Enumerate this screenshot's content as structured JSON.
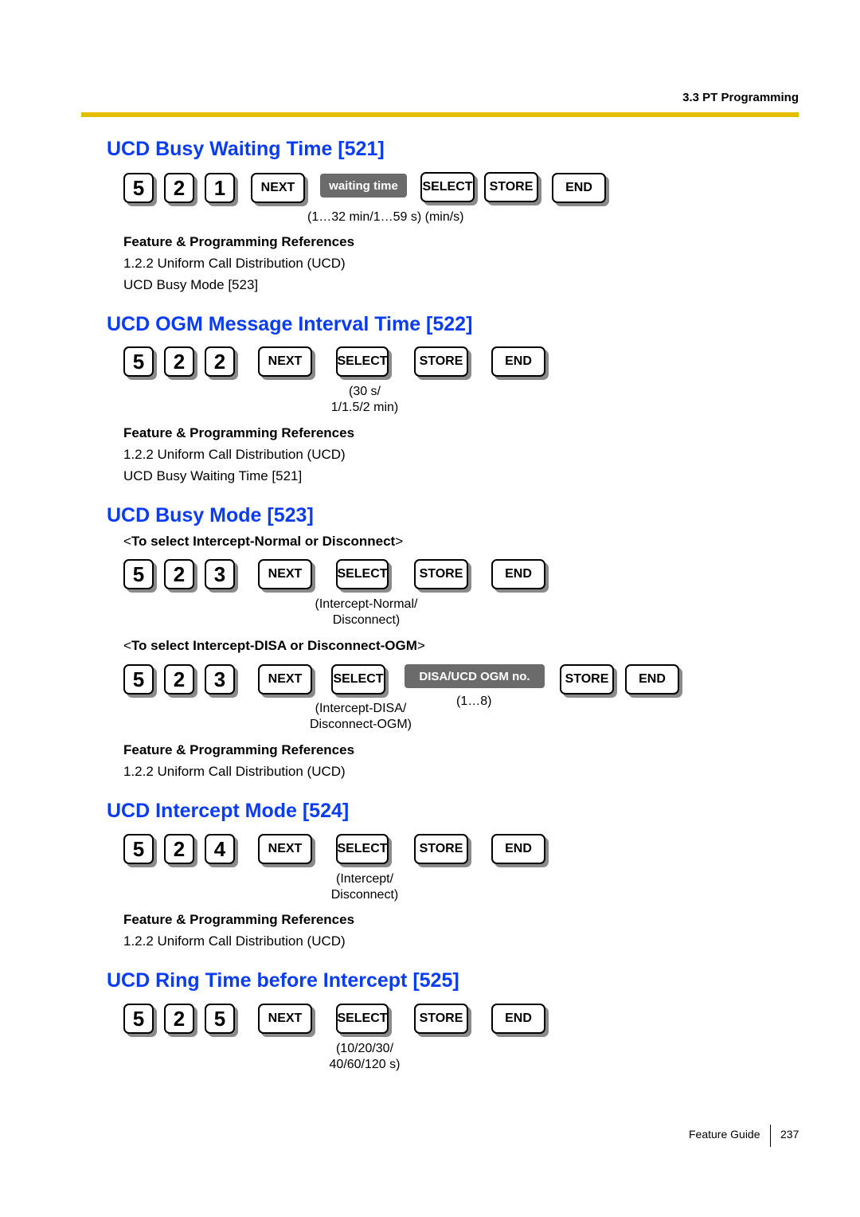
{
  "header": {
    "section": "3.3 PT Programming",
    "rule_color": "#e3bd00"
  },
  "heading_color": "#0a3cf5",
  "sections": [
    {
      "title": "UCD Busy Waiting Time [521]",
      "keys": [
        "5",
        "2",
        "1",
        "NEXT",
        "waiting time",
        "SELECT",
        "STORE",
        "END"
      ],
      "notes": [
        "(1…32 min/1…59 s)  (min/s)"
      ],
      "refs_heading": "Feature & Programming References",
      "refs": [
        "1.2.2 Uniform Call Distribution (UCD)",
        "UCD Busy Mode [523]"
      ]
    },
    {
      "title": "UCD OGM Message Interval Time [522]",
      "keys": [
        "5",
        "2",
        "2",
        "NEXT",
        "SELECT",
        "STORE",
        "END"
      ],
      "notes": [
        "(30 s/",
        "1/1.5/2 min)"
      ],
      "refs_heading": "Feature & Programming References",
      "refs": [
        "1.2.2 Uniform Call Distribution (UCD)",
        "UCD Busy Waiting Time [521]"
      ]
    },
    {
      "title": "UCD Busy Mode [523]",
      "sub1": "To select Intercept-Normal or Disconnect",
      "keys1": [
        "5",
        "2",
        "3",
        "NEXT",
        "SELECT",
        "STORE",
        "END"
      ],
      "notes1": [
        "(Intercept-Normal/",
        "Disconnect)"
      ],
      "sub2": "To select Intercept-DISA or Disconnect-OGM",
      "keys2": [
        "5",
        "2",
        "3",
        "NEXT",
        "SELECT",
        "DISA/UCD OGM no.",
        "STORE",
        "END"
      ],
      "notes2": [
        "(Intercept-DISA/",
        "Disconnect-OGM)",
        "(1…8)"
      ],
      "refs_heading": "Feature & Programming References",
      "refs": [
        "1.2.2 Uniform Call Distribution (UCD)"
      ]
    },
    {
      "title": "UCD Intercept Mode [524]",
      "keys": [
        "5",
        "2",
        "4",
        "NEXT",
        "SELECT",
        "STORE",
        "END"
      ],
      "notes": [
        "(Intercept/",
        "Disconnect)"
      ],
      "refs_heading": "Feature & Programming References",
      "refs": [
        "1.2.2 Uniform Call Distribution (UCD)"
      ]
    },
    {
      "title": "UCD Ring Time before Intercept [525]",
      "keys": [
        "5",
        "2",
        "5",
        "NEXT",
        "SELECT",
        "STORE",
        "END"
      ],
      "notes": [
        "(10/20/30/",
        "40/60/120 s)"
      ]
    }
  ],
  "brackets": {
    "open": "<",
    "close": ">"
  },
  "footer": {
    "label": "Feature Guide",
    "page": "237"
  }
}
